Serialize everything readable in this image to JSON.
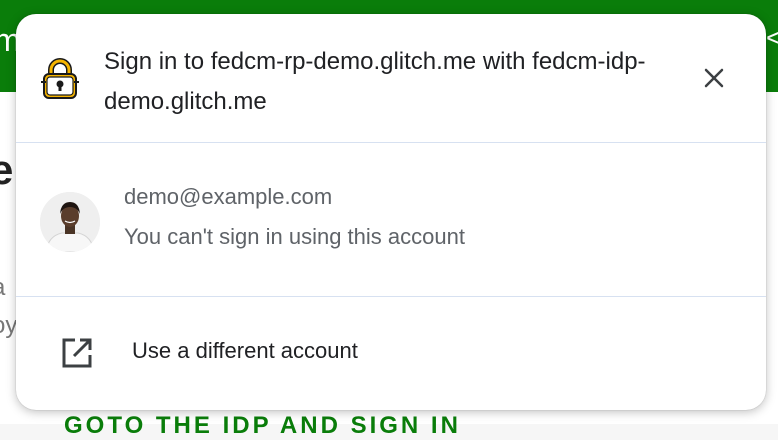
{
  "background": {
    "header_left_char": "m",
    "header_right_char": "<",
    "heading_char": "e",
    "line1_char": "a",
    "line2_chars": "oy",
    "link_text": "GOTO THE IDP AND SIGN IN"
  },
  "dialog": {
    "title": "Sign in to fedcm-rp-demo.glitch.me with fedcm-idp-demo.glitch.me",
    "idp_icon": "padlock-logo",
    "close_icon": "close-icon",
    "account": {
      "email": "demo@example.com",
      "status": "You can't sign in using this account"
    },
    "use_other": {
      "icon": "open-external-icon",
      "label": "Use a different account"
    }
  },
  "colors": {
    "header_green": "#0a7d0a",
    "text_primary": "#202124",
    "text_secondary": "#5f6368",
    "divider": "#d7e1f1"
  }
}
